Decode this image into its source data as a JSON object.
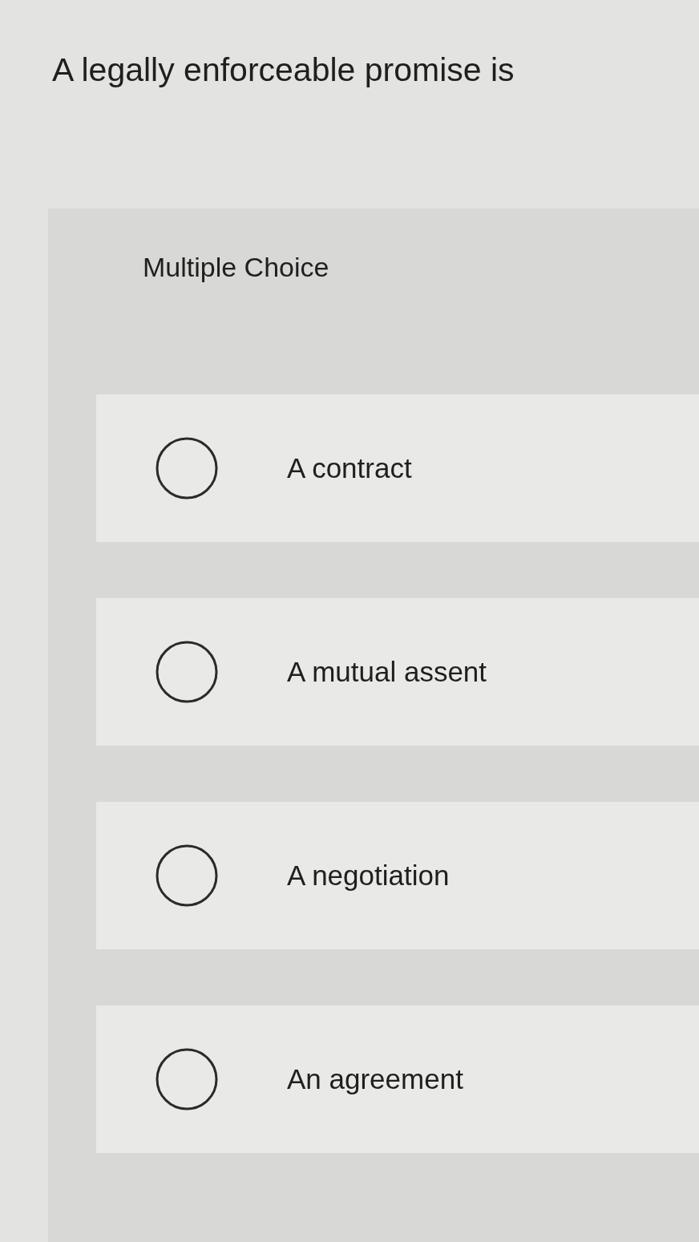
{
  "question": "A legally enforceable promise is",
  "panel": {
    "heading": "Multiple Choice",
    "options": [
      {
        "label": "A contract",
        "selected": false
      },
      {
        "label": "A mutual assent",
        "selected": false
      },
      {
        "label": "A negotiation",
        "selected": false
      },
      {
        "label": "An agreement",
        "selected": false
      }
    ]
  }
}
